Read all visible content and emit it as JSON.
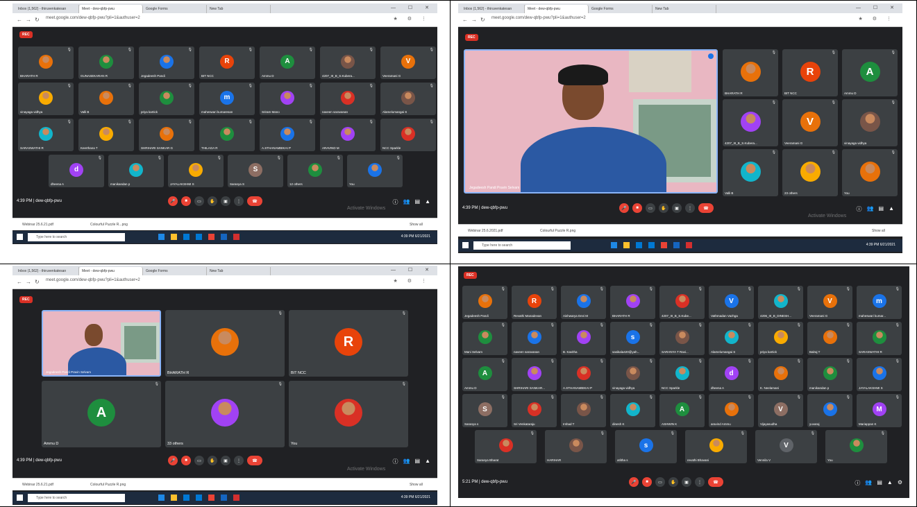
{
  "browser": {
    "tabs": [
      "Inbox (1,562) - thiruvenkatesan",
      "Meet - dew-qbfp-pwu",
      "Google Forms",
      "New Tab"
    ],
    "url": "meet.google.com/dew-qbfp-pwu?pli=1&authuser=2",
    "window_controls": "— ☐ ✕"
  },
  "rec_label": "REC",
  "meeting_code": "dew-qbfp-pwu",
  "panel1": {
    "time": "4:39 PM",
    "tiles": [
      "BHARATH R",
      "GUNASEKARAN R",
      "Jegadeesh Pandi",
      "BIT NCC",
      "Ammu D",
      "4207_III_B_S.Kubera...",
      "Veeramani G",
      "vinayaga vidhya",
      "Valli B",
      "priya kartick",
      "maheswari kumaresan",
      "Sriram Mano",
      "naveen saravanan",
      "Alamelumangai S",
      "SARASWATHI R",
      "Keerthana T",
      "SHRIHARI SANKAR G",
      "THILAGA R",
      "A.STHANAMBIKAI P",
      "ARAVIND M",
      "NCC Sparkle",
      "dheena A",
      "manikandan p",
      "JAYALAKSHMI S",
      "Saranya S",
      "12 others",
      "You"
    ],
    "downloads": [
      "Webinar 25.6.21.pdf",
      "Colourful Puzzle R...png",
      "Show all"
    ],
    "watermark": "Activate Windows",
    "search": "Type here to search",
    "clock": "4:39 PM 6/21/2021"
  },
  "panel2": {
    "time": "4:39 PM",
    "speaker": "Jegadeesh Pandi Pravin Selvam",
    "tiles": [
      "BHARATH R",
      "BIT NCC",
      "Ammu D",
      "4207_III_B_S.Kubera...",
      "Veeramani G",
      "vinayaga vidhya",
      "Valli B",
      "23 others",
      "You"
    ],
    "downloads": [
      "Webinar 25.6.2021.pdf",
      "Colourful Puzzle R.png",
      "Show all"
    ],
    "watermark": "Activate Windows",
    "search": "Type here to search",
    "clock": "4:39 PM 6/21/2021"
  },
  "panel3": {
    "time": "4:39 PM",
    "speaker": "Jegadeesh Pandi Pravin Selvam",
    "tiles": [
      "BHARATH R",
      "BIT NCC",
      "Ammu D",
      "33 others",
      "You"
    ],
    "downloads": [
      "Webinar 25.6.21.pdf",
      "Colourful Puzzle R.png",
      "Show all"
    ],
    "watermark": "Activate Windows",
    "search": "Type here to search",
    "clock": "4:39 PM 6/21/2021"
  },
  "panel4": {
    "time": "5:21 PM",
    "tiles": [
      "Jegadeesh Pandi",
      "Revathi Manadevan",
      "Aishwarya Devi M",
      "BHARATH R",
      "4207_III_B_S.Kube...",
      "Vathmadan Vazhga",
      "4206_III_B_DINESH...",
      "Veeramani G",
      "maheswari kumar...",
      "Mani Selvam",
      "naveen saravanan",
      "B. Kavitha",
      "sasikala420@yah...",
      "SARANYA T Ravi...",
      "Alamelumangai S",
      "priya kartick",
      "Balraj T",
      "SARASWATHI R",
      "Ammu D",
      "SHRIHARI SANKAR...",
      "A.STHANAMBIKAI P",
      "vinayaga vidhya",
      "NCC Sparkle",
      "dheena A",
      "K. Neelamani",
      "manikandan p",
      "JAYALAKSHMI S",
      "Saranya s",
      "Sri Venkataraju",
      "Irshad T",
      "dinesh K",
      "ASHWIN K",
      "aravind Ammu",
      "Vijayasudha",
      "yuvaraj",
      "Mariappan K",
      "Saranya Bharat",
      "HARIHAR",
      "atlitha s",
      "revathi Bhavani",
      "Vennila V",
      "You"
    ]
  }
}
